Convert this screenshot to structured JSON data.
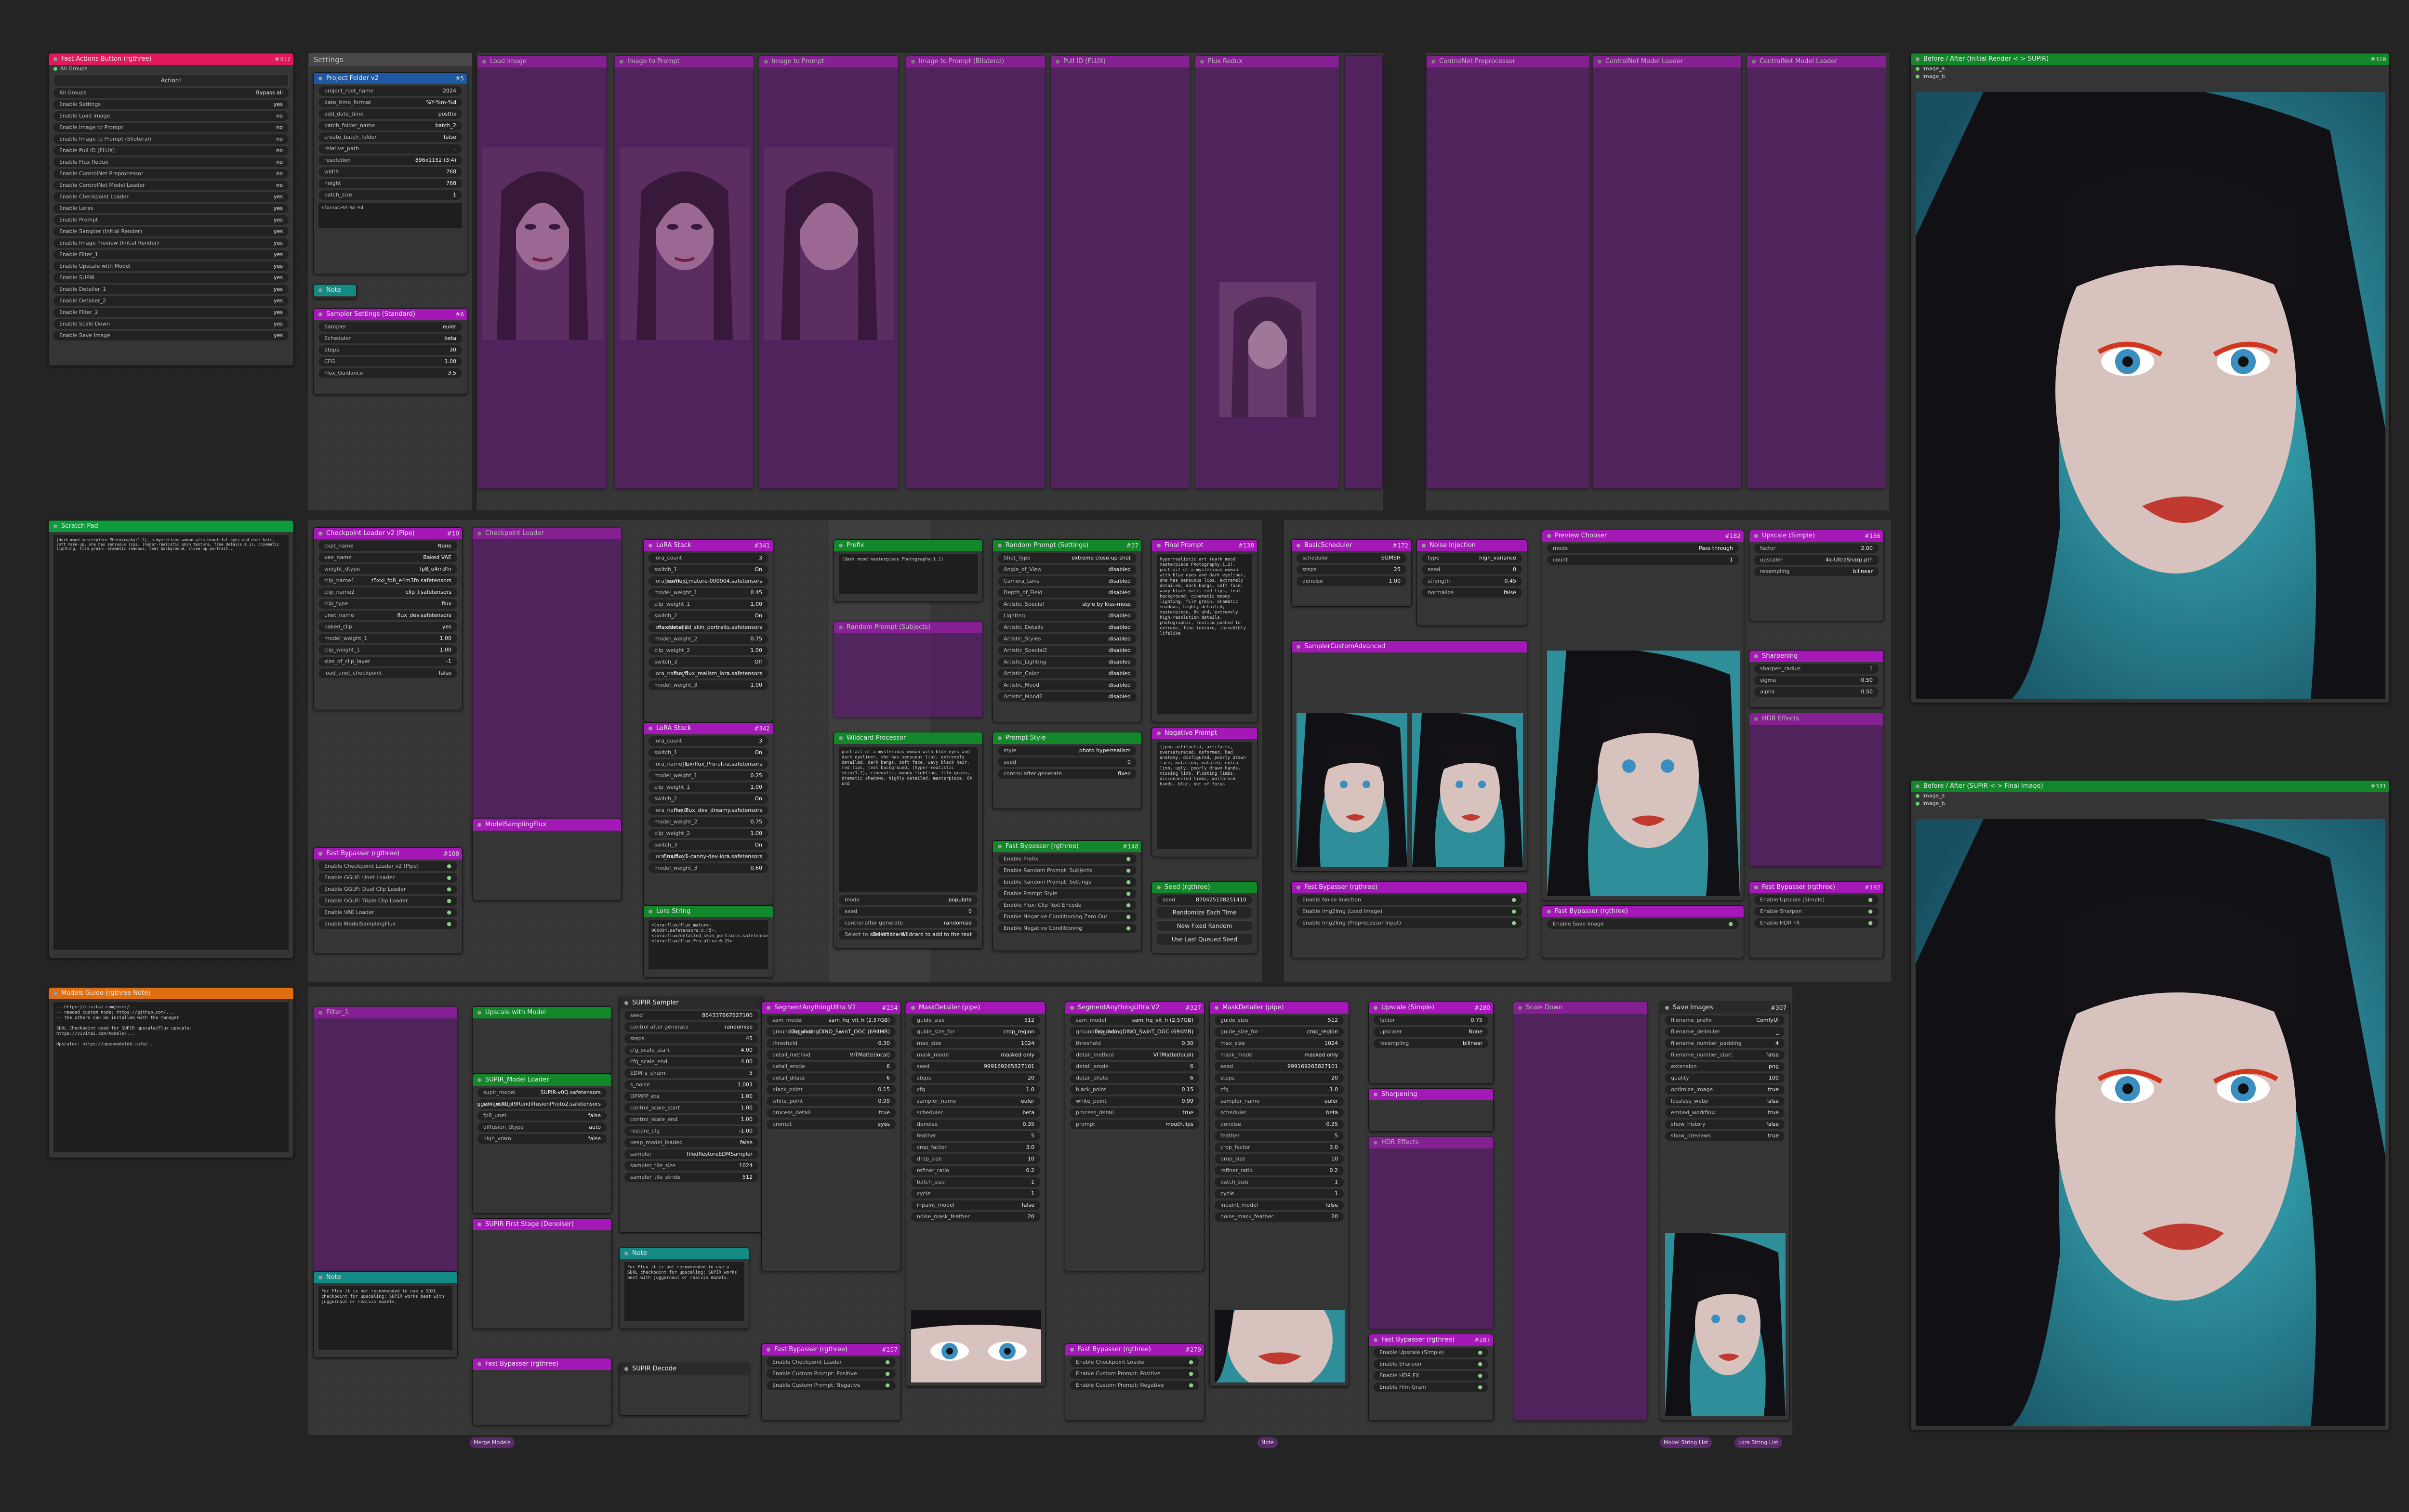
{
  "app": {
    "title": "ComfyUI"
  },
  "colors": {
    "canvas": "#242424",
    "bypass_node": "#5b1d6b",
    "magenta_title": "#a418b8",
    "pink_title": "#e0195d",
    "green_title": "#12882a",
    "orange_title": "#e06f12",
    "teal_title": "#148c85",
    "blue_title": "#1d58a0"
  },
  "fast_actions": {
    "title": "Fast Actions Button (rgthree)",
    "id": "#317",
    "widget_all_groups": "All Groups",
    "action_label": "Action!",
    "mode_label": "All Groups",
    "mode_value": "Bypass all",
    "toggles": [
      {
        "label": "Enable Settings",
        "value": "yes"
      },
      {
        "label": "Enable Load Image",
        "value": "no"
      },
      {
        "label": "Enable Image to Prompt",
        "value": "no"
      },
      {
        "label": "Enable Image to Prompt (Bilateral)",
        "value": "no"
      },
      {
        "label": "Enable Pull ID (FLUX)",
        "value": "no"
      },
      {
        "label": "Enable Flux Redux",
        "value": "no"
      },
      {
        "label": "Enable ControlNet Preprocessor",
        "value": "no"
      },
      {
        "label": "Enable ControlNet Model Loader",
        "value": "no"
      },
      {
        "label": "Enable Checkpoint Loader",
        "value": "yes"
      },
      {
        "label": "Enable Loras",
        "value": "yes"
      },
      {
        "label": "Enable Prompt",
        "value": "yes"
      },
      {
        "label": "Enable Sampler (Initial Render)",
        "value": "yes"
      },
      {
        "label": "Enable Image Preview (Initial Render)",
        "value": "yes"
      },
      {
        "label": "Enable Filter_1",
        "value": "yes"
      },
      {
        "label": "Enable Upscale with Model",
        "value": "yes"
      },
      {
        "label": "Enable SUPIR",
        "value": "yes"
      },
      {
        "label": "Enable Detailer_1",
        "value": "yes"
      },
      {
        "label": "Enable Detailer_2",
        "value": "yes"
      },
      {
        "label": "Enable Filter_2",
        "value": "yes"
      },
      {
        "label": "Enable Scale Down",
        "value": "yes"
      },
      {
        "label": "Enable Save Image",
        "value": "yes"
      }
    ]
  },
  "scratch_pad": {
    "title": "Scratch Pad",
    "text": "(dark mood masterpiece Photography:1.2), a mysterious woman with beautiful eyes and dark hair, soft make-up, she has sensuous lips, (hyper-realistic skin texture, fine details:1.3), cinematic lighting, film grain, dramatic shadows, teal background, close-up portrait..."
  },
  "notes": {
    "title": "Models Guide (rgthree Note)",
    "text": "-- https://civitai.com/user/...\n-- needed custom node: https://github.com/...\n-- the others can be installed with the manager\n\nSDXL Checkpoint used for SUPIR upscale/Flux upscale:\nhttps://civitai.com/models/...\n\nUpscaler: https://openmodeldb.info/..."
  },
  "groups": {
    "settings": "Settings",
    "load_image": "Load Image",
    "image_to_prompt": "Image to Prompt",
    "image_to_prompt_bilateral": "Image to Prompt (Bilateral)",
    "pull_id": "Pull ID (FLUX)",
    "flux_redux": "Flux Redux",
    "controlnet_pre": "ControlNet Preprocessor",
    "controlnet_model": "ControlNet Model Loader",
    "checkpoint": "Checkpoint Loader",
    "loras": "Loras",
    "prompt": "Prompt",
    "sampler": "Sampler (Initial Render)",
    "preview": "Image Preview (Initial Render)",
    "filter1": "Filter_1",
    "upscale": "Upscale with Model",
    "supir": "SUPIR",
    "detailer1": "Detailer_1",
    "detailer2": "Detailer_2",
    "filter2": "Filter_2",
    "scale_down": "Scale Down",
    "save": "Save Image"
  },
  "project_folder": {
    "title": "Project Folder v2",
    "id": "#5",
    "w": [
      [
        "project_root_name",
        "2024"
      ],
      [
        "date_time_format",
        "%Y-%m-%d"
      ],
      [
        "add_date_time",
        "postfix"
      ],
      [
        "batch_folder_name",
        "batch_2"
      ],
      [
        "create_batch_folder",
        "false"
      ],
      [
        "relative_path",
        "."
      ],
      [
        "resolution",
        "896x1152 (3:4)"
      ],
      [
        "width",
        "768"
      ],
      [
        "height",
        "768"
      ],
      [
        "batch_size",
        "1"
      ]
    ],
    "note": "<format>%Y-%m-%d"
  },
  "sampler_settings": {
    "title": "Sampler Settings (Standard)",
    "id": "#6",
    "w": [
      [
        "Sampler",
        "euler"
      ],
      [
        "Scheduler",
        "beta"
      ],
      [
        "Steps",
        "30"
      ],
      [
        "CFG",
        "1.00"
      ],
      [
        "Flux_Guidance",
        "3.5"
      ]
    ]
  },
  "checkpoint_loader": {
    "title": "Checkpoint Loader v2 (Pipe)",
    "id": "#10",
    "w": [
      [
        "ckpt_name",
        "None"
      ],
      [
        "vae_name",
        "Baked VAE"
      ],
      [
        "weight_dtype",
        "fp8_e4m3fn"
      ],
      [
        "clip_name1",
        "t5xxl_fp8_e4m3fn.safetensors"
      ],
      [
        "clip_name2",
        "clip_l.safetensors"
      ],
      [
        "clip_type",
        "flux"
      ],
      [
        "unet_name",
        "flux_dev.safetensors"
      ],
      [
        "baked_clip",
        "yes"
      ],
      [
        "model_weight_1",
        "1.00"
      ],
      [
        "clip_weight_1",
        "1.00"
      ],
      [
        "size_of_clip_layer",
        "-1"
      ],
      [
        "load_unet_checkpoint",
        "false"
      ]
    ]
  },
  "lora_stack1": {
    "title": "LoRA Stack",
    "id": "#341",
    "w": [
      [
        "lora_count",
        "3"
      ],
      [
        "switch_1",
        "On"
      ],
      [
        "lora_name_1",
        "flux/flux_mature-000004.safetensors"
      ],
      [
        "model_weight_1",
        "0.45"
      ],
      [
        "clip_weight_1",
        "1.00"
      ],
      [
        "switch_2",
        "On"
      ],
      [
        "lora_name_2",
        "flux/detailed_skin_portraits.safetensors"
      ],
      [
        "model_weight_2",
        "0.75"
      ],
      [
        "clip_weight_2",
        "1.00"
      ],
      [
        "switch_3",
        "Off"
      ],
      [
        "lora_name_3",
        "flux/flux_realism_lora.safetensors"
      ],
      [
        "model_weight_3",
        "1.00"
      ]
    ]
  },
  "lora_stack2": {
    "title": "LoRA Stack",
    "id": "#342",
    "w": [
      [
        "lora_count",
        "3"
      ],
      [
        "switch_1",
        "On"
      ],
      [
        "lora_name_1",
        "flux/flux_Pro-ultra.safetensors"
      ],
      [
        "model_weight_1",
        "0.25"
      ],
      [
        "clip_weight_1",
        "1.00"
      ],
      [
        "switch_2",
        "On"
      ],
      [
        "lora_name_2",
        "flux/flux_dev_dreamy.safetensors"
      ],
      [
        "model_weight_2",
        "0.75"
      ],
      [
        "clip_weight_2",
        "1.00"
      ],
      [
        "switch_3",
        "On"
      ],
      [
        "lora_name_3",
        "flux/flux1-canny-dev-lora.safetensors"
      ],
      [
        "model_weight_3",
        "0.60"
      ]
    ]
  },
  "lora_string": {
    "title": "Lora String",
    "text": "<lora:flux/flux_mature-000004.safetensors:0.45>, <lora:flux/detailed_skin_portraits.safetensors:0.75>, <lora:flux/flux_Pro-ultra:0.25>"
  },
  "prefix": {
    "title": "Prefix",
    "text": "(dark mood masterpiece Photography:1.2)"
  },
  "wildcard": {
    "title": "Wildcard Processor",
    "text": "portrait of a mysterious woman with blue eyes and dark eyeliner, she has sensuous lips, extremely detailed, dark bangs, soft face, wavy black hair, red lips, teal background, (hyper-realistic skin:1.2), cinematic, moody lighting, film grain, dramatic shadows, highly detailed, masterpiece, 8k uhd",
    "w": [
      [
        "mode",
        "populate"
      ],
      [
        "seed",
        "0"
      ],
      [
        "control after generate",
        "randomize"
      ],
      [
        "Select to add Wildcard",
        "Select the Wildcard to add to the text"
      ]
    ]
  },
  "prompt_settings": {
    "title": "Random Prompt (Settings)",
    "id": "#37",
    "w": [
      [
        "Shot_Type",
        "extreme close-up shot"
      ],
      [
        "Angle_of_View",
        "disabled"
      ],
      [
        "Camera_Lens",
        "disabled"
      ],
      [
        "Depth_of_Field",
        "disabled"
      ],
      [
        "Artistic_Special",
        "style by kiss-moss"
      ],
      [
        "Lighting",
        "disabled"
      ],
      [
        "Artistic_Details",
        "disabled"
      ],
      [
        "Artistic_Styles",
        "disabled"
      ],
      [
        "Artistic_Special2",
        "disabled"
      ],
      [
        "Artistic_Lighting",
        "disabled"
      ],
      [
        "Artistic_Color",
        "disabled"
      ],
      [
        "Artistic_Mood",
        "disabled"
      ],
      [
        "Artistic_Mood2",
        "disabled"
      ]
    ]
  },
  "prompt_style": {
    "title": "Prompt Style",
    "w": [
      [
        "style",
        "photo hyperrealism"
      ],
      [
        "seed",
        "0"
      ],
      [
        "control after generate",
        "fixed"
      ]
    ]
  },
  "final_prompt": {
    "title": "Final Prompt",
    "id": "#138",
    "text": "hyperrealistic art (dark mood masterpiece Photography:1.2), portrait of a mysterious woman with blue eyes and dark eyeliner, she has sensuous lips, extremely detailed, dark bangs, soft face, wavy black hair, red lips, teal background, cinematic moody lighting, film grain, dramatic shadows, highly detailed, masterpiece, 8k uhd, extremely high-resolution details, photographic, realism pushed to extreme, fine texture, incredibly lifelike"
  },
  "negative": {
    "title": "Negative Prompt",
    "text": "(jpeg artifacts), artifacts, oversaturated, deformed, bad anatomy, disfigured, poorly drawn face, mutation, mutated, extra limb, ugly, poorly drawn hands, missing limb, floating limbs, disconnected limbs, malformed hands, blur, out of focus"
  },
  "seed": {
    "title": "Seed (rgthree)",
    "value": "870425108251410",
    "btn1": "Randomize Each Time",
    "btn2": "New Fixed Random",
    "btn3": "Use Last Queued Seed"
  },
  "basic_scheduler": {
    "title": "BasicScheduler",
    "id": "#172",
    "w": [
      [
        "scheduler",
        "SGMSH"
      ],
      [
        "steps",
        "25"
      ],
      [
        "denoise",
        "1.00"
      ]
    ]
  },
  "noise_injection": {
    "title": "Noise Injection",
    "w": [
      [
        "type",
        "high_variance"
      ],
      [
        "seed",
        "0"
      ],
      [
        "strength",
        "0.45"
      ],
      [
        "normalize",
        "false"
      ]
    ]
  },
  "preview_chooser": {
    "title": "Preview Chooser",
    "id": "#182",
    "w": [
      [
        "mode",
        "Pass through"
      ],
      [
        "count",
        "1"
      ]
    ]
  },
  "upscale_simple": {
    "title": "Upscale (Simple)",
    "id": "#186",
    "w": [
      [
        "factor",
        "2.00"
      ],
      [
        "upscaler",
        "4x-UltraSharp.pth"
      ],
      [
        "resampling",
        "bilinear"
      ]
    ]
  },
  "sharpening": {
    "title": "Sharpening",
    "w": [
      [
        "sharpen_radius",
        "1"
      ],
      [
        "sigma",
        "0.50"
      ],
      [
        "alpha",
        "0.50"
      ]
    ]
  },
  "supir": {
    "title": "SUPIR Sampler",
    "w": [
      [
        "seed",
        "864337667627100"
      ],
      [
        "control after generate",
        "randomize"
      ],
      [
        "steps",
        "45"
      ],
      [
        "cfg_scale_start",
        "4.00"
      ],
      [
        "cfg_scale_end",
        "4.00"
      ],
      [
        "EDM_s_churn",
        "5"
      ],
      [
        "s_noise",
        "1.003"
      ],
      [
        "DPMPP_eta",
        "1.00"
      ],
      [
        "control_scale_start",
        "1.00"
      ],
      [
        "control_scale_end",
        "1.00"
      ],
      [
        "restore_cfg",
        "-1.00"
      ],
      [
        "keep_model_loaded",
        "false"
      ],
      [
        "sampler",
        "TiledRestoreEDMSampler"
      ],
      [
        "sampler_tile_size",
        "1024"
      ],
      [
        "sampler_tile_stride",
        "512"
      ]
    ]
  },
  "supir_model": {
    "title": "SUPIR_Model Loader",
    "w": [
      [
        "supir_model",
        "SUPIR-v0Q.safetensors"
      ],
      [
        "sdxl_model",
        "juggernautXL_v9RundiffusionPhoto2.safetensors"
      ],
      [
        "fp8_unet",
        "false"
      ],
      [
        "diffusion_dtype",
        "auto"
      ],
      [
        "high_vram",
        "false"
      ]
    ]
  },
  "supir_note": {
    "title": "Note",
    "text": "For Flux it is not recommended to use a SDXL checkpoint for upscaling; SUPIR works best with juggernaut or realvis models."
  },
  "detailer1": {
    "title": "SegmentAnythingUltra V2",
    "id": "#254",
    "w": [
      [
        "sam_model",
        "sam_hq_vit_h (2.57GB)"
      ],
      [
        "grounding_dino",
        "GroundingDINO_SwinT_OGC (694MB)"
      ],
      [
        "threshold",
        "0.30"
      ],
      [
        "detail_method",
        "VITMatte(local)"
      ],
      [
        "detail_erode",
        "6"
      ],
      [
        "detail_dilate",
        "6"
      ],
      [
        "black_point",
        "0.15"
      ],
      [
        "white_point",
        "0.99"
      ],
      [
        "process_detail",
        "true"
      ],
      [
        "prompt",
        "eyes"
      ]
    ]
  },
  "detailer_mask": {
    "title": "MaskDetailer (pipe)",
    "w": [
      [
        "guide_size",
        "512"
      ],
      [
        "guide_size_for",
        "crop_region"
      ],
      [
        "max_size",
        "1024"
      ],
      [
        "mask_mode",
        "masked only"
      ],
      [
        "seed",
        "999169265827101"
      ],
      [
        "steps",
        "20"
      ],
      [
        "cfg",
        "1.0"
      ],
      [
        "sampler_name",
        "euler"
      ],
      [
        "scheduler",
        "beta"
      ],
      [
        "denoise",
        "0.35"
      ],
      [
        "feather",
        "5"
      ],
      [
        "crop_factor",
        "3.0"
      ],
      [
        "drop_size",
        "10"
      ],
      [
        "refiner_ratio",
        "0.2"
      ],
      [
        "batch_size",
        "1"
      ],
      [
        "cycle",
        "1"
      ],
      [
        "inpaint_model",
        "false"
      ],
      [
        "noise_mask_feather",
        "20"
      ]
    ]
  },
  "detailer2": {
    "title": "SegmentAnythingUltra V2",
    "id": "#327",
    "w": [
      [
        "sam_model",
        "sam_hq_vit_h (2.57GB)"
      ],
      [
        "grounding_dino",
        "GroundingDINO_SwinT_OGC (694MB)"
      ],
      [
        "threshold",
        "0.30"
      ],
      [
        "detail_method",
        "VITMatte(local)"
      ],
      [
        "detail_erode",
        "6"
      ],
      [
        "detail_dilate",
        "6"
      ],
      [
        "black_point",
        "0.15"
      ],
      [
        "white_point",
        "0.99"
      ],
      [
        "process_detail",
        "true"
      ],
      [
        "prompt",
        "mouth,lips"
      ]
    ]
  },
  "filter2_upscale": {
    "title": "Upscale (Simple)",
    "id": "#280",
    "w": [
      [
        "factor",
        "0.75"
      ],
      [
        "upscaler",
        "None"
      ],
      [
        "resampling",
        "bilinear"
      ]
    ]
  },
  "save_images": {
    "title": "Save Images",
    "id": "#307",
    "w": [
      [
        "filename_prefix",
        "ComfyUI"
      ],
      [
        "filename_delimiter",
        "_"
      ],
      [
        "filename_number_padding",
        "4"
      ],
      [
        "filename_number_start",
        "false"
      ],
      [
        "extension",
        "png"
      ],
      [
        "quality",
        "100"
      ],
      [
        "optimize_image",
        "true"
      ],
      [
        "lossless_webp",
        "false"
      ],
      [
        "embed_workflow",
        "true"
      ],
      [
        "show_history",
        "false"
      ],
      [
        "show_previews",
        "true"
      ]
    ]
  },
  "compare1": {
    "title": "Before / After (Initial Render <-> SUPIR)",
    "id": "#316",
    "image_a": "image_a",
    "image_b": "image_b"
  },
  "compare2": {
    "title": "Before / After (SUPIR <-> Final Image)",
    "id": "#331",
    "image_a": "image_a",
    "image_b": "image_b"
  },
  "fast_bypassers": {
    "loader": {
      "title": "Fast Bypasser (rgthree)",
      "id": "#108",
      "items": [
        "Enable Checkpoint Loader v2 (Pipe)",
        "Enable GGUF: Unet Loader",
        "Enable GGUF: Dual Clip Loader",
        "Enable GGUF: Triple Clip Loader",
        "Enable VAE Loader",
        "Enable ModelSamplingFlux"
      ]
    },
    "prompt": {
      "title": "Fast Bypasser (rgthree)",
      "id": "#148",
      "items": [
        "Enable Prefix",
        "Enable Random Prompt: Subjects",
        "Enable Random Prompt: Settings",
        "Enable Prompt Style",
        "Enable Flux: Clip Text Encode",
        "Enable Negative Conditioning Zero Out",
        "Enable Negative Conditioning"
      ]
    },
    "sampler": {
      "title": "Fast Bypasser (rgthree)",
      "items": [
        "Enable Noise Injection",
        "Enable Img2Img (Load Image)",
        "Enable Img2Img (Preprocessor Input)"
      ]
    },
    "preview": {
      "title": "Fast Bypasser (rgthree)",
      "items": [
        "Enable Save Image"
      ]
    },
    "upscale": {
      "title": "Fast Bypasser (rgthree)",
      "id": "#192",
      "items": [
        "Enable Upscale (Simple)",
        "Enable Sharpen",
        "Enable HDR FX"
      ]
    },
    "d1": {
      "title": "Fast Bypasser (rgthree)",
      "id": "#257",
      "items": [
        "Enable Checkpoint Loader",
        "Enable Custom Prompt: Positive",
        "Enable Custom Prompt: Negative"
      ]
    },
    "d2": {
      "title": "Fast Bypasser (rgthree)",
      "id": "#279",
      "items": [
        "Enable Checkpoint Loader",
        "Enable Custom Prompt: Positive",
        "Enable Custom Prompt: Negative"
      ]
    },
    "filter2": {
      "title": "Fast Bypasser (rgthree)",
      "id": "#287",
      "items": [
        "Enable Upscale (Simple)",
        "Enable Sharpen",
        "Enable HDR FX",
        "Enable Film Grain"
      ]
    }
  },
  "chips": {
    "ctx": "ctx",
    "merge_models": "Merge Models",
    "merge_lora": "Merge Lora",
    "model_string": "Model String List",
    "lora_string": "Lora String List",
    "note": "Note"
  }
}
